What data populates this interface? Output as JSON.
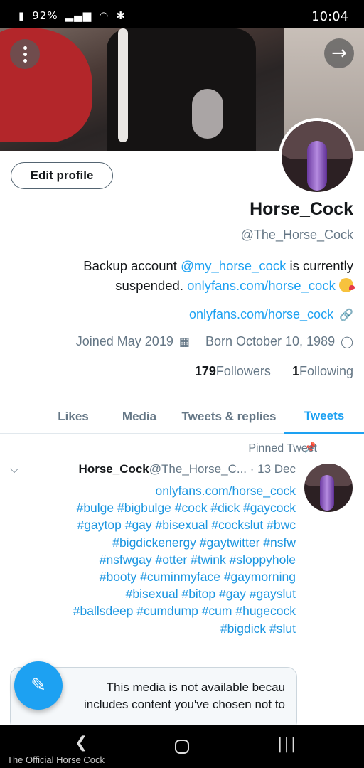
{
  "status_bar": {
    "time": "10:04",
    "battery": "92%",
    "icons": [
      "bluetooth-icon",
      "wifi-icon",
      "signal-icon",
      "battery-icon"
    ]
  },
  "header": {
    "icons": {
      "menu": "kebab-icon",
      "forward": "arrow-right-icon"
    }
  },
  "profile": {
    "edit_button": "Edit profile",
    "name": "Horse_Cock",
    "handle": "@The_Horse_Cock",
    "bio_line1_prefix": "Backup account ",
    "bio_mention": "@my_horse_cock",
    "bio_line1_suffix": " is currently",
    "bio_line2_prefix": "suspended. ",
    "bio_link": "onlyfans.com/horse_cock",
    "website": "onlyfans.com/horse_cock",
    "birthday": "Born October 10, 1989",
    "joined": "Joined May 2019",
    "following_count": "1",
    "following_label": "Following",
    "followers_count": "179",
    "followers_label": "Followers"
  },
  "tabs": [
    {
      "label": "Tweets",
      "active": true
    },
    {
      "label": "Tweets & replies",
      "active": false
    },
    {
      "label": "Media",
      "active": false
    },
    {
      "label": "Likes",
      "active": false
    }
  ],
  "pinned_tweet": {
    "pinned_label": "Pinned Tweet",
    "author_name": "Horse_Cock",
    "author_handle_date": "@The_Horse_C... · 13 Dec",
    "lines": [
      "onlyfans.com/horse_cock",
      "#bulge #bigbulge #cock #dick #gaycock",
      "#gaytop #gay #bisexual #cockslut #bwc",
      "#bigdickenergy #gaytwitter #nsfw",
      "#nsfwgay #otter #twink #sloppyhole",
      "#booty #cuminmyface #gaymorning",
      "#bisexual #bitop #gay #gayslut",
      "#ballsdeep #cumdump #cum #hugecock",
      "#bigdick #slut"
    ],
    "media_notice_line1": "This media is not available becau",
    "media_notice_line2": "includes content you've chosen not to"
  },
  "fab": {
    "icon": "compose-tweet-icon"
  },
  "nav_bar": {
    "caption": "The Official Horse Cock"
  },
  "colors": {
    "accent": "#1da1f2",
    "text": "#14171a",
    "secondary": "#657786"
  }
}
